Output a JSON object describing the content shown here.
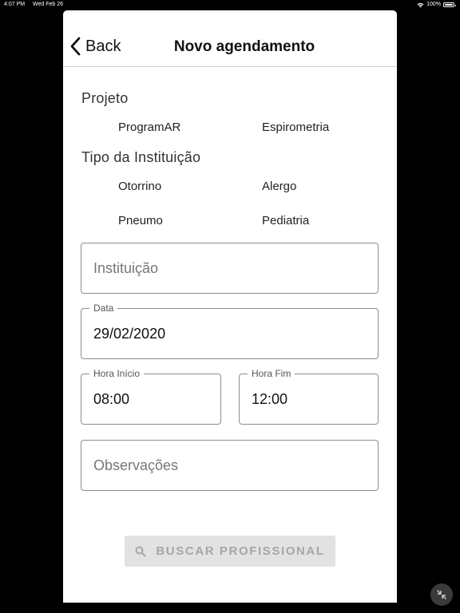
{
  "status_bar": {
    "time": "4:07 PM",
    "date": "Wed Feb 26",
    "battery": "100%"
  },
  "navbar": {
    "back_label": "Back",
    "title": "Novo agendamento"
  },
  "projeto": {
    "label": "Projeto",
    "options": [
      "ProgramAR",
      "Espirometria"
    ]
  },
  "tipo_instituicao": {
    "label": "Tipo da Instituição",
    "options": [
      "Otorrino",
      "Alergo",
      "Pneumo",
      "Pediatria"
    ]
  },
  "form": {
    "instituicao": {
      "placeholder": "Instituição"
    },
    "data": {
      "label": "Data",
      "value": "29/02/2020"
    },
    "hora_inicio": {
      "label": "Hora Início",
      "value": "08:00"
    },
    "hora_fim": {
      "label": "Hora Fim",
      "value": "12:00"
    },
    "observacoes": {
      "placeholder": "Observações"
    }
  },
  "actions": {
    "buscar_label": "BUSCAR PROFISSIONAL"
  },
  "icons": {
    "back": "chevron-left-icon",
    "search": "search-icon",
    "wifi": "wifi-icon",
    "battery": "battery-icon",
    "collapse": "collapse-icon"
  },
  "colors": {
    "button_disabled_bg": "#e2e2e2",
    "button_disabled_text": "#a6a6a6",
    "border": "#8d8d8d"
  }
}
